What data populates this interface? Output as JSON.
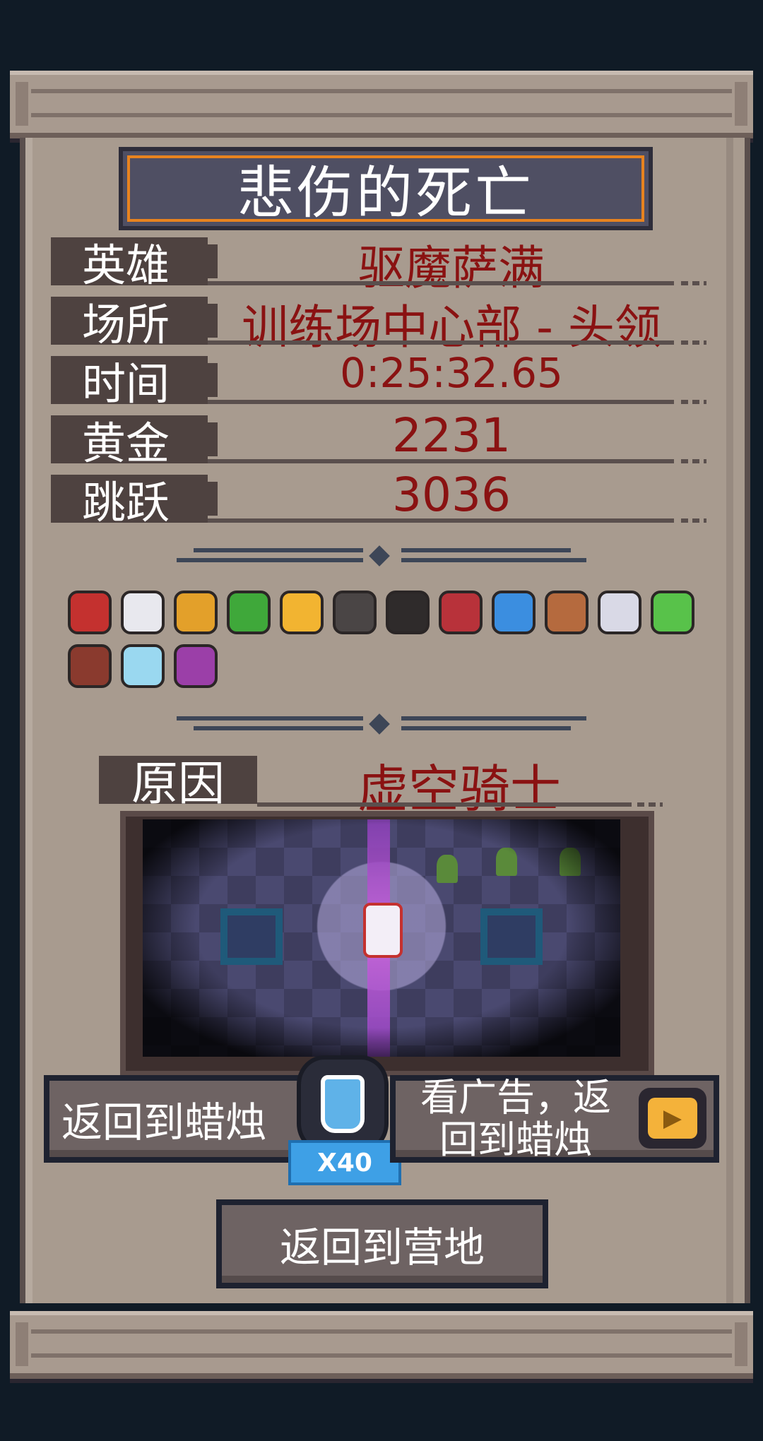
{
  "title": "悲伤的死亡",
  "stats": [
    {
      "label": "英雄",
      "value": "驱魔萨满"
    },
    {
      "label": "场所",
      "value": "训练场中心部 - 头领"
    },
    {
      "label": "时间",
      "value": "0:25:32.65"
    },
    {
      "label": "黄金",
      "value": "2231"
    },
    {
      "label": "跳跃",
      "value": "3036"
    }
  ],
  "items": [
    {
      "icon": "red-orb-icon",
      "color": "#c4312f"
    },
    {
      "icon": "white-stone-icon",
      "color": "#e8e8ee"
    },
    {
      "icon": "golden-boot-icon",
      "color": "#e3a02a"
    },
    {
      "icon": "four-leaf-clover-icon",
      "color": "#3fa83a"
    },
    {
      "icon": "golden-diamond-icon",
      "color": "#f2b431"
    },
    {
      "icon": "dark-rock-icon",
      "color": "#4a4545"
    },
    {
      "icon": "dark-ring-icon",
      "color": "#2f2b2b"
    },
    {
      "icon": "red-bomb-icon",
      "color": "#b8323a"
    },
    {
      "icon": "blue-ghost-icon",
      "color": "#3b8ee0"
    },
    {
      "icon": "bread-icon",
      "color": "#b56a3e"
    },
    {
      "icon": "bone-icon",
      "color": "#d9d9e6"
    },
    {
      "icon": "green-leaf-icon",
      "color": "#58c24a"
    },
    {
      "icon": "treasure-chest-icon",
      "color": "#8a3a2e"
    },
    {
      "icon": "blue-book-icon",
      "color": "#9ad8f0"
    },
    {
      "icon": "purple-cross-icon",
      "color": "#9b3fa8"
    }
  ],
  "cause": {
    "label": "原因",
    "value": "虚空骑士"
  },
  "buttons": {
    "return_candle": "返回到蜡烛",
    "candle_cost": "X40",
    "ad_return_line1": "看广告，返",
    "ad_return_line2": "回到蜡烛",
    "return_camp": "返回到营地"
  }
}
